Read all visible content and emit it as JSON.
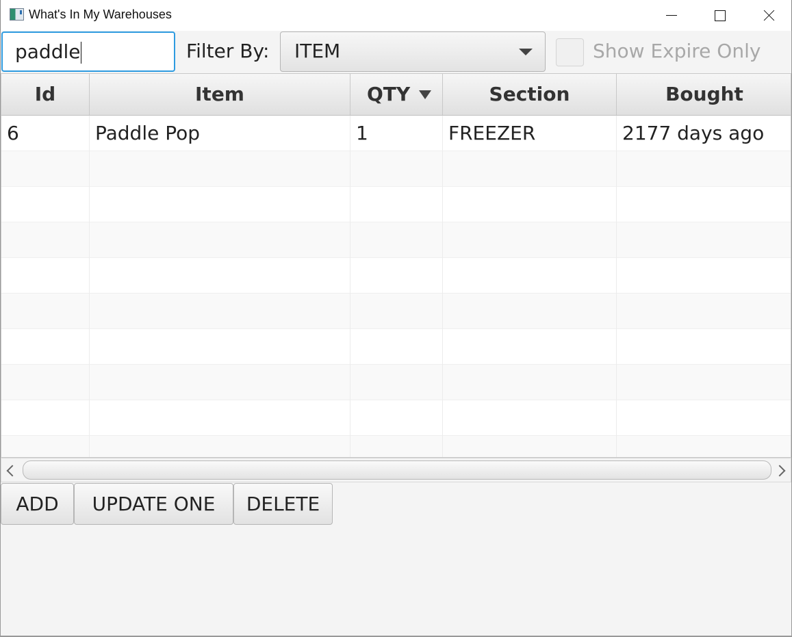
{
  "window": {
    "title": "What's In My Warehouses"
  },
  "toolbar": {
    "search_value": "paddle",
    "filter_label": "Filter By:",
    "filter_selected": "ITEM",
    "show_expire_label": "Show Expire Only",
    "show_expire_checked": false
  },
  "table": {
    "columns": [
      "Id",
      "Item",
      "QTY",
      "Section",
      "Bought"
    ],
    "sorted_column": "QTY",
    "sort_direction": "descending",
    "rows": [
      [
        "6",
        "Paddle Pop",
        "1",
        "FREEZER",
        "2177 days ago"
      ]
    ]
  },
  "actions": {
    "add_label": "ADD",
    "update_label": "UPDATE ONE",
    "delete_label": "DELETE"
  },
  "icons": {
    "app": "warehouse-app-icon",
    "minimize": "minimize-icon",
    "maximize": "maximize-icon",
    "close": "close-icon",
    "dropdown": "chevron-down-icon",
    "sort": "sort-descending-icon"
  },
  "colors": {
    "focus_accent": "#2e9be0",
    "background": "#f4f4f4"
  }
}
